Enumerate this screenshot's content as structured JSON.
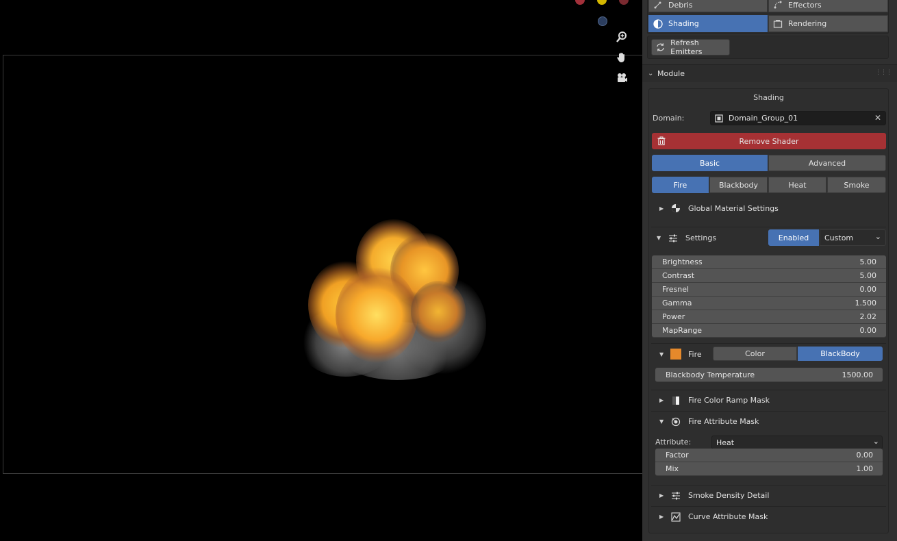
{
  "tabs": {
    "debris": "Debris",
    "effectors": "Effectors",
    "shading": "Shading",
    "rendering": "Rendering"
  },
  "refresh_label": "Refresh Emitters",
  "module": {
    "title": "Module",
    "section_title": "Shading",
    "domain_label": "Domain:",
    "domain_value": "Domain_Group_01",
    "remove_shader": "Remove Shader",
    "mode_basic": "Basic",
    "mode_advanced": "Advanced",
    "fire_tab": "Fire",
    "blackbody_tab": "Blackbody",
    "heat_tab": "Heat",
    "smoke_tab": "Smoke",
    "global_settings": "Global Material Settings"
  },
  "settings": {
    "title": "Settings",
    "enabled": "Enabled",
    "preset": "Custom",
    "rows": [
      {
        "name": "Brightness",
        "value": "5.00"
      },
      {
        "name": "Contrast",
        "value": "5.00"
      },
      {
        "name": "Fresnel",
        "value": "0.00"
      },
      {
        "name": "Gamma",
        "value": "1.500"
      },
      {
        "name": "Power",
        "value": "2.02"
      },
      {
        "name": "MapRange",
        "value": "0.00"
      }
    ]
  },
  "fire": {
    "title": "Fire",
    "color_btn": "Color",
    "blackbody_btn": "BlackBody",
    "temp_label": "Blackbody Temperature",
    "temp_value": "1500.00",
    "color_ramp_mask": "Fire Color Ramp Mask",
    "attribute_mask": "Fire Attribute Mask",
    "attribute_label": "Attribute:",
    "attribute_value": "Heat",
    "factor_label": "Factor",
    "factor_value": "0.00",
    "mix_label": "Mix",
    "mix_value": "1.00"
  },
  "smoke_density_detail": "Smoke Density Detail",
  "curve_attribute_mask": "Curve Attribute Mask",
  "colors": {
    "accent": "#4772b3",
    "danger": "#a63134",
    "panel_bg": "#303030",
    "fire_swatch": "#e5892b"
  }
}
